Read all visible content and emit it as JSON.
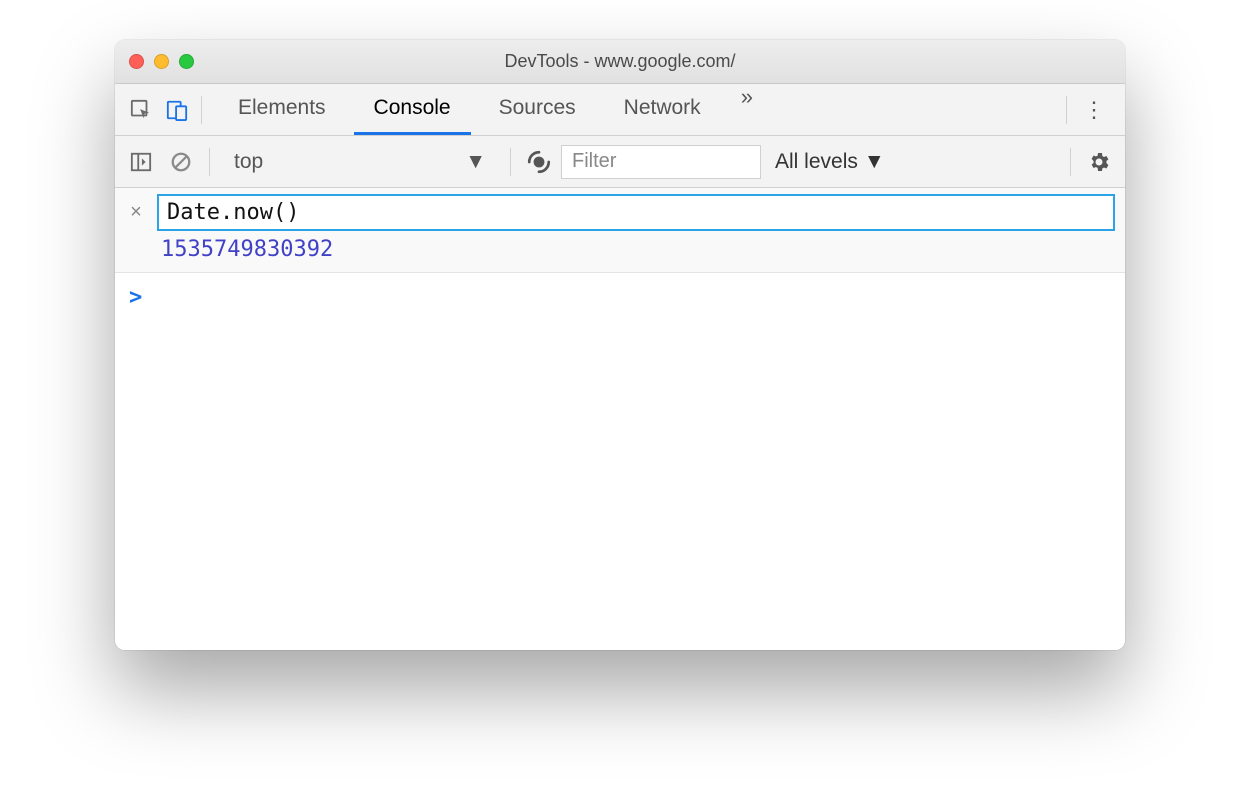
{
  "window": {
    "title": "DevTools - www.google.com/"
  },
  "tabs": {
    "items": [
      "Elements",
      "Console",
      "Sources",
      "Network"
    ],
    "active_index": 1,
    "overflow_glyph": "»"
  },
  "console_toolbar": {
    "context": "top",
    "filter_placeholder": "Filter",
    "levels_label": "All levels"
  },
  "console": {
    "expression": "Date.now()",
    "result": "1535749830392",
    "prompt_glyph": ">"
  }
}
